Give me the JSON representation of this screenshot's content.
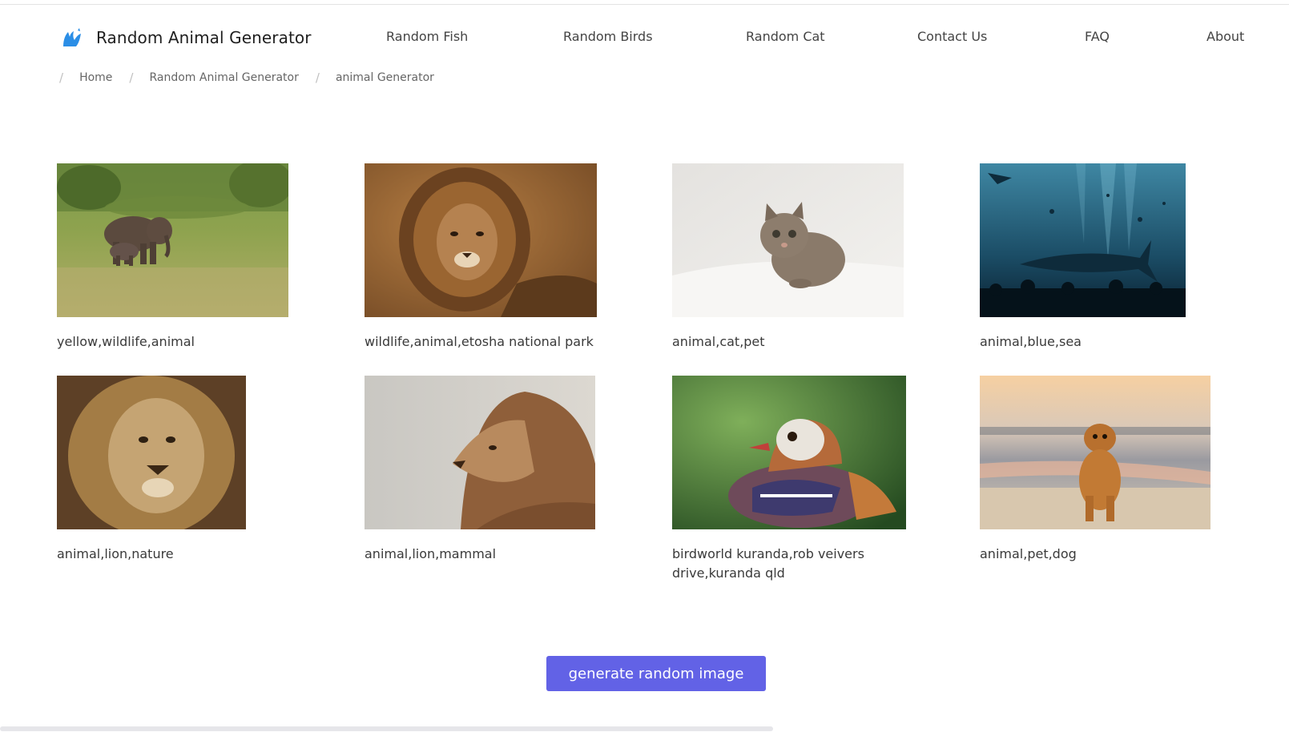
{
  "header": {
    "brand_title": "Random Animal Generator",
    "nav": [
      "Random Fish",
      "Random Birds",
      "Random Cat",
      "Contact Us",
      "FAQ",
      "About"
    ]
  },
  "breadcrumb": [
    "Home",
    "Random Animal Generator",
    "animal Generator"
  ],
  "gallery": [
    {
      "caption": "yellow,wildlife,animal",
      "subject": "elephant-photo"
    },
    {
      "caption": "wildlife,animal,etosha national park",
      "subject": "lion-photo"
    },
    {
      "caption": "animal,cat,pet",
      "subject": "kitten-photo"
    },
    {
      "caption": "animal,blue,sea",
      "subject": "aquarium-whale-shark-photo"
    },
    {
      "caption": "animal,lion,nature",
      "subject": "lion-portrait-photo"
    },
    {
      "caption": "animal,lion,mammal",
      "subject": "lion-profile-photo"
    },
    {
      "caption": "birdworld kuranda,rob veivers drive,kuranda qld",
      "subject": "mandarin-duck-photo"
    },
    {
      "caption": "animal,pet,dog",
      "subject": "golden-retriever-beach-photo"
    }
  ],
  "generate_button": "generate random image",
  "colors": {
    "accent": "#6262e6",
    "brand_icon": "#2b8ee6"
  }
}
